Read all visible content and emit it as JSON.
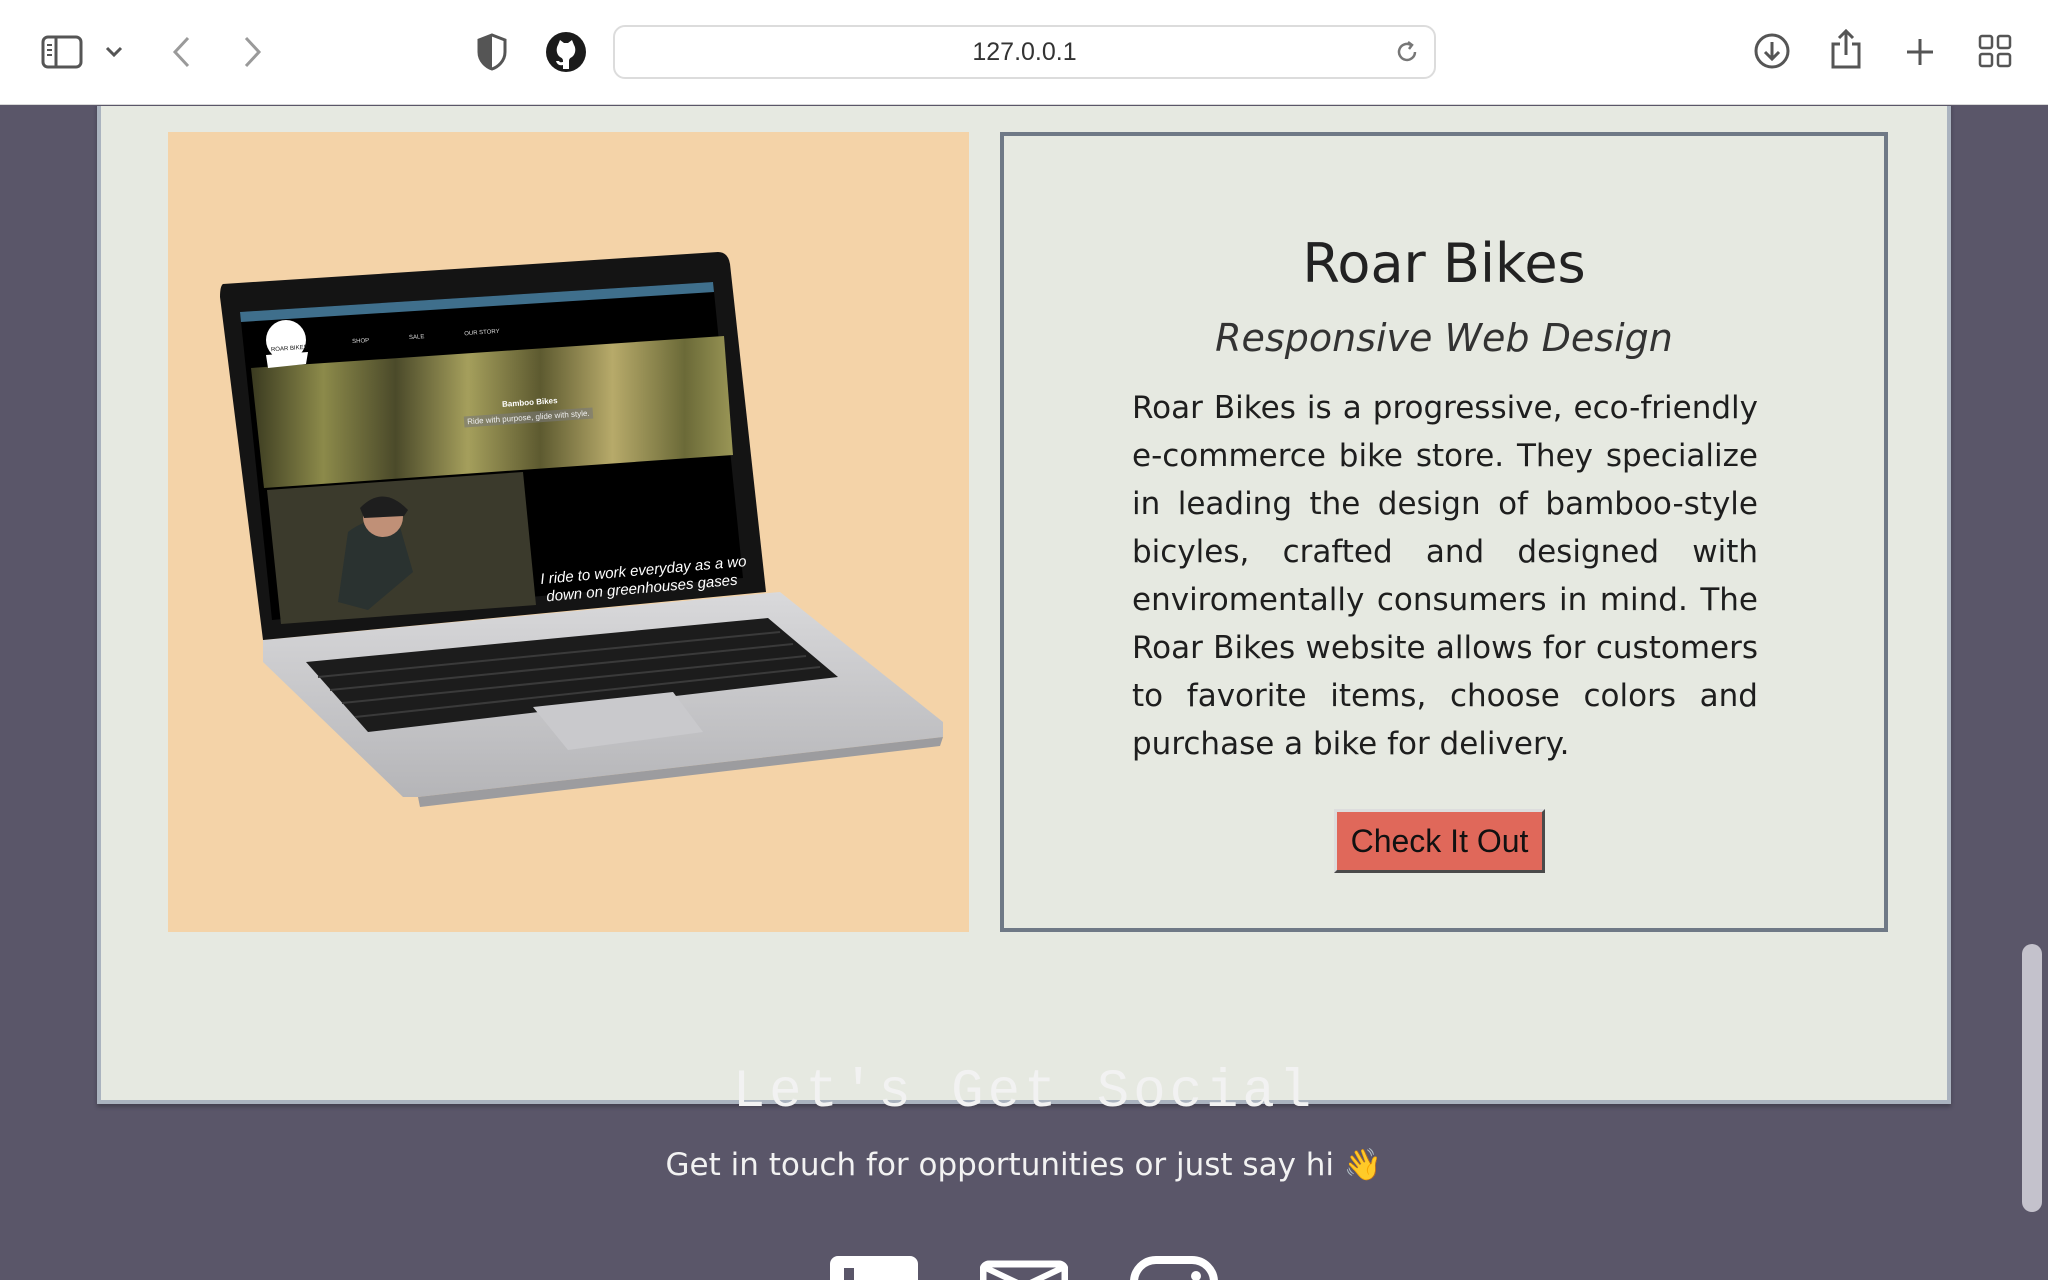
{
  "browser": {
    "url": "127.0.0.1",
    "icons": {
      "sidebar": "sidebar-icon",
      "dropdown": "chevron-down-icon",
      "back": "back-arrow-icon",
      "forward": "forward-arrow-icon",
      "shield": "shield-icon",
      "github": "github-icon",
      "reload": "reload-icon",
      "download": "download-icon",
      "share": "share-icon",
      "new_tab": "plus-icon",
      "tab_overview": "grid-icon"
    }
  },
  "project": {
    "title": "Roar Bikes",
    "subtitle": "Responsive Web Design",
    "description": "Roar Bikes is a progressive, eco-friendly e-commerce bike store. They specialize in leading the design of bamboo-style bicyles, crafted and designed with enviromentally consumers in mind. The Roar Bikes website allows for customers to favorite items, choose colors and purchase a bike for delivery.",
    "button_label": "Check It Out",
    "image": {
      "nav_items": [
        "SHOP",
        "SALE",
        "OUR STORY"
      ],
      "logo_text": "ROAR BIKES",
      "hero_title": "Bamboo Bikes",
      "hero_tagline": "Ride with purpose, glide with style.",
      "quote_line1": "I ride to work everyday as a wo",
      "quote_line2": "down on greenhouses gases"
    }
  },
  "social": {
    "heading": "Let's Get Social",
    "subheading": "Get in touch for opportunities or just say hi 👋",
    "icons": [
      "linkedin-icon",
      "email-icon",
      "instagram-icon"
    ]
  },
  "colors": {
    "page_bg": "#5a5669",
    "card_bg": "#e6e9e1",
    "image_bg": "#f4d3a8",
    "button_bg": "#e0685a"
  }
}
